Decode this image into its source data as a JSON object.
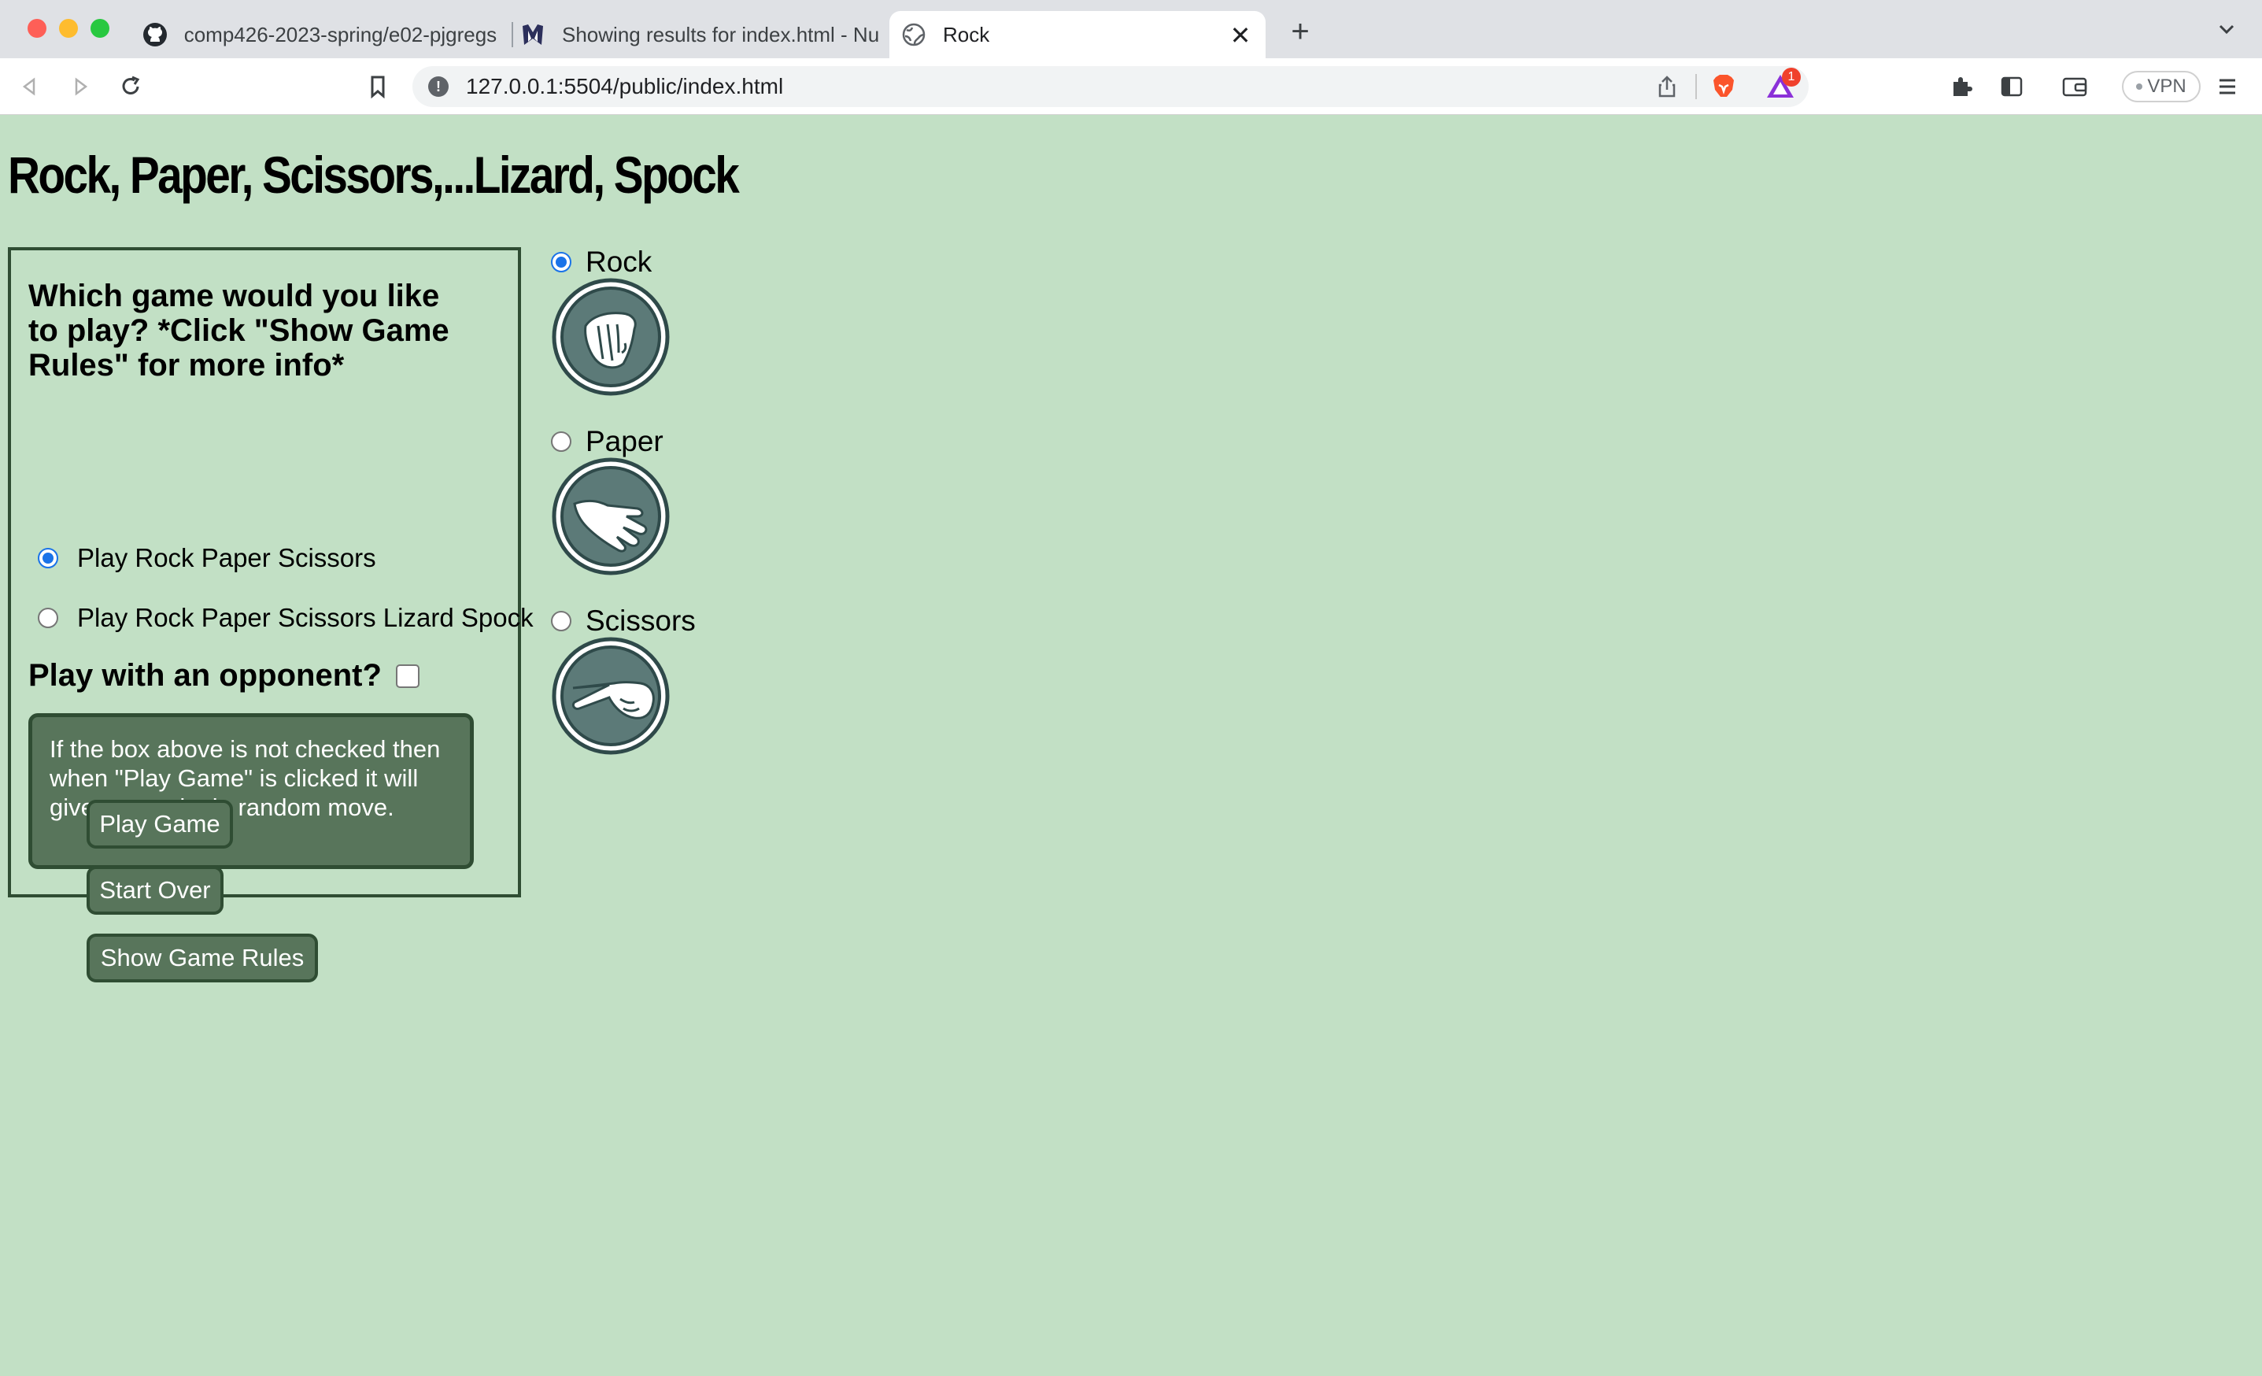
{
  "browser": {
    "tabs": [
      {
        "title": "comp426-2023-spring/e02-pjgregs",
        "icon": "github-icon"
      },
      {
        "title": "Showing results for index.html - Nu",
        "icon": "nu-icon"
      },
      {
        "title": "Rock",
        "icon": "globe-icon",
        "active": true
      }
    ],
    "url": "127.0.0.1:5504/public/index.html",
    "rewards_badge": "1",
    "vpn_label": "VPN"
  },
  "page": {
    "title": "Rock, Paper, Scissors,...Lizard, Spock",
    "question": "Which game would you like to play? *Click \"Show Game Rules\" for more info*",
    "modes": [
      {
        "label": "Play Rock Paper Scissors",
        "checked": true
      },
      {
        "label": "Play Rock Paper Scissors Lizard Spock",
        "checked": false
      }
    ],
    "opponent_label": "Play with an opponent?",
    "opponent_checked": false,
    "note": "If the box above is not checked then when \"Play Game\" is clicked it will give you a single random move.",
    "buttons": {
      "play": "Play Game",
      "start_over": "Start Over",
      "rules": "Show Game Rules"
    },
    "moves": [
      {
        "label": "Rock",
        "checked": true,
        "icon": "rock-hand-icon"
      },
      {
        "label": "Paper",
        "checked": false,
        "icon": "paper-hand-icon"
      },
      {
        "label": "Scissors",
        "checked": false,
        "icon": "scissors-hand-icon"
      }
    ]
  },
  "colors": {
    "page_bg": "#c2e0c5",
    "button_bg": "#58755b",
    "border": "#2f4d33",
    "hand_circle": "#5c7a78"
  }
}
